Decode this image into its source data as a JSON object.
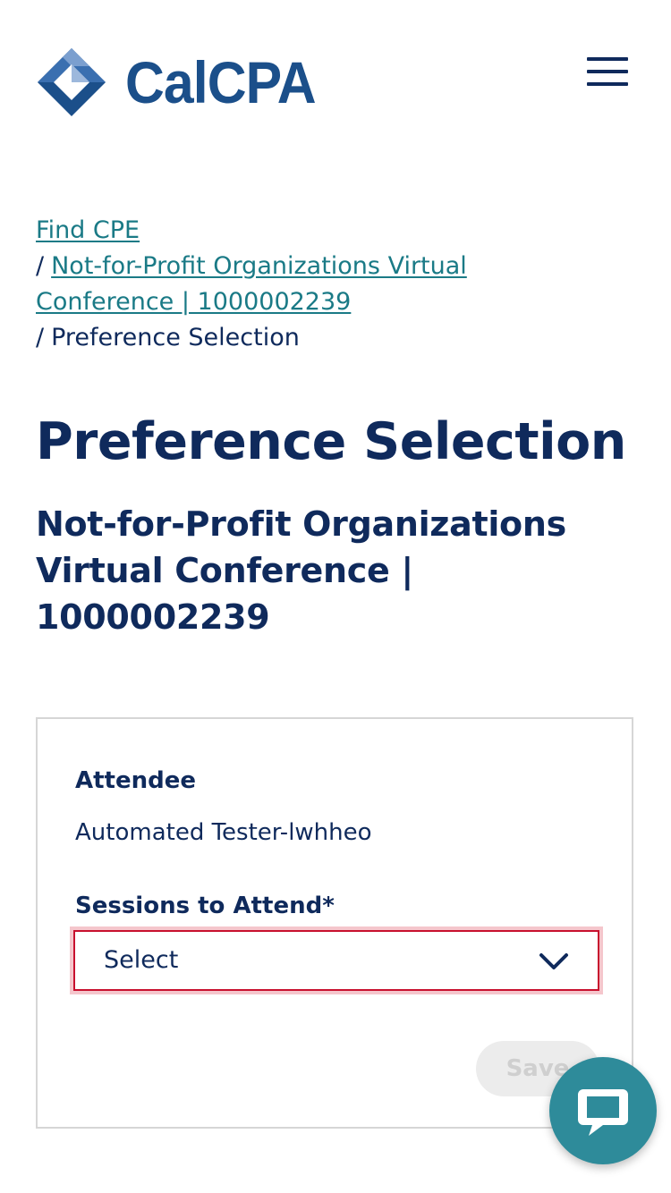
{
  "header": {
    "logo_text": "CalCPA",
    "logo_mark_colors": {
      "dark": "#1b4f8a",
      "light": "#7b9fcf",
      "mid": "#3a6fb0"
    },
    "menu_icon": "hamburger-icon"
  },
  "breadcrumb": {
    "separator": "/",
    "items": [
      {
        "label": "Find CPE",
        "link": true
      },
      {
        "label": "Not-for-Profit Organizations Virtual Conference | 1000002239",
        "link": true
      },
      {
        "label": "Preference Selection",
        "link": false
      }
    ]
  },
  "page": {
    "title": "Preference Selection",
    "event_title": "Not-for-Profit Organizations Virtual Conference | 1000002239"
  },
  "form": {
    "attendee_label": "Attendee",
    "attendee_value": "Automated Tester-lwhheo",
    "sessions_label": "Sessions to Attend*",
    "sessions_selected": "Select",
    "save_label": "Save",
    "error_color": "#c8102e"
  },
  "chat": {
    "icon": "chat-bubble-icon",
    "color": "#2e8b9a"
  }
}
